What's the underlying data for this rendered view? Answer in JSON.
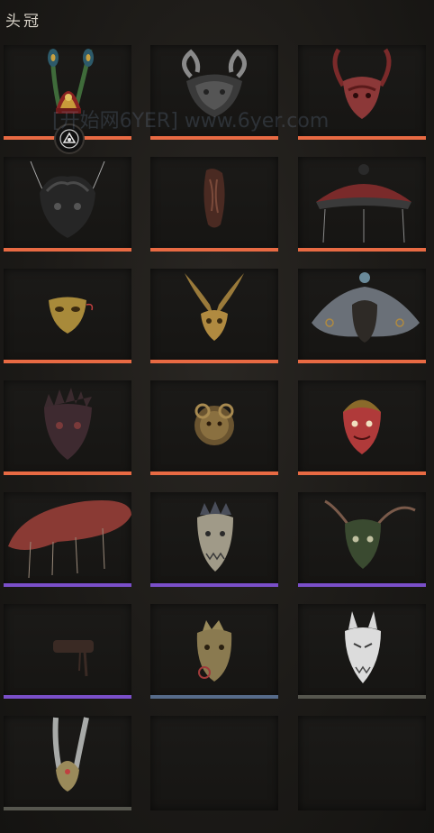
{
  "header": {
    "title": "头冠"
  },
  "watermark": "[开始网6YER] www.6yer.com",
  "colors": {
    "orange": "#e86a43",
    "purple": "#7a4fc9",
    "blue": "#566b8a",
    "gray": "#56564e"
  },
  "slots": [
    {
      "name": "peacock-feather-crown",
      "rarity": "orange",
      "icon": "feather-crown-icon",
      "equipped": true
    },
    {
      "name": "ram-horn-mask",
      "rarity": "orange",
      "icon": "horned-skull-icon"
    },
    {
      "name": "red-horned-mask",
      "rarity": "orange",
      "icon": "red-demon-mask-icon"
    },
    {
      "name": "black-flame-mask",
      "rarity": "orange",
      "icon": "black-demon-mask-icon"
    },
    {
      "name": "twisted-wood-mask",
      "rarity": "orange",
      "icon": "wood-mask-icon"
    },
    {
      "name": "red-parasol-hat",
      "rarity": "orange",
      "icon": "parasol-hat-icon"
    },
    {
      "name": "gold-half-mask",
      "rarity": "orange",
      "icon": "gold-mask-icon"
    },
    {
      "name": "gold-winged-mask",
      "rarity": "orange",
      "icon": "winged-mask-icon"
    },
    {
      "name": "gray-cloth-hood",
      "rarity": "orange",
      "icon": "hood-icon"
    },
    {
      "name": "dark-spiked-mask",
      "rarity": "orange",
      "icon": "spiked-mask-icon"
    },
    {
      "name": "bronze-lion-mask",
      "rarity": "orange",
      "icon": "lion-mask-icon"
    },
    {
      "name": "red-faced-crown",
      "rarity": "orange",
      "icon": "red-face-icon"
    },
    {
      "name": "mushroom-hat",
      "rarity": "purple",
      "icon": "mushroom-hat-icon"
    },
    {
      "name": "dragon-head-helm",
      "rarity": "purple",
      "icon": "dragon-helm-icon"
    },
    {
      "name": "green-horned-mask",
      "rarity": "purple",
      "icon": "green-demon-icon"
    },
    {
      "name": "headband",
      "rarity": "purple",
      "icon": "headband-icon"
    },
    {
      "name": "gold-beast-helm",
      "rarity": "blue",
      "icon": "beast-helm-icon"
    },
    {
      "name": "white-wolf-mask",
      "rarity": "gray",
      "icon": "wolf-mask-icon"
    },
    {
      "name": "silver-feather-crown",
      "rarity": "gray",
      "icon": "silver-feather-icon"
    },
    {
      "name": "empty-slot-1",
      "rarity": "none",
      "icon": ""
    },
    {
      "name": "empty-slot-2",
      "rarity": "none",
      "icon": ""
    }
  ]
}
